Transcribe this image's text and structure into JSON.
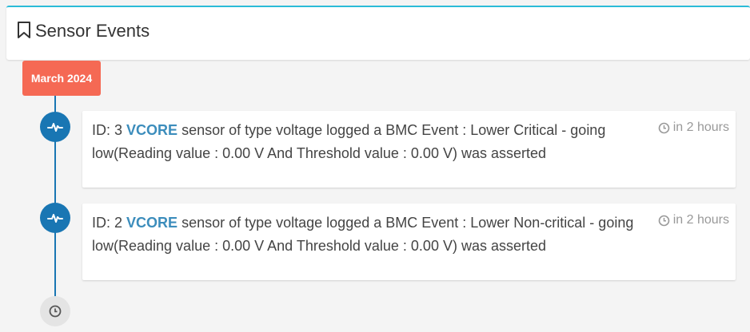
{
  "header": {
    "title": "Sensor Events",
    "icon": "bookmark-icon"
  },
  "timeline": {
    "month_label": "March 2024",
    "events": [
      {
        "id_prefix": "ID: 3",
        "sensor": "VCORE",
        "message": "sensor of type voltage logged a BMC Event : Lower Critical - going low(Reading value : 0.00 V And Threshold value : 0.00 V) was asserted",
        "time": "in 2 hours",
        "icon": "heartbeat-icon"
      },
      {
        "id_prefix": "ID: 2",
        "sensor": "VCORE",
        "message": "sensor of type voltage logged a BMC Event : Lower Non-critical - going low(Reading value : 0.00 V And Threshold value : 0.00 V) was asserted",
        "time": "in 2 hours",
        "icon": "heartbeat-icon"
      }
    ],
    "end_icon": "clock-icon"
  },
  "colors": {
    "accent_top_border": "#2bbbd8",
    "month_label_bg": "#f56954",
    "timeline_blue": "#1976b3",
    "sensor_link": "#3c8dbc"
  }
}
